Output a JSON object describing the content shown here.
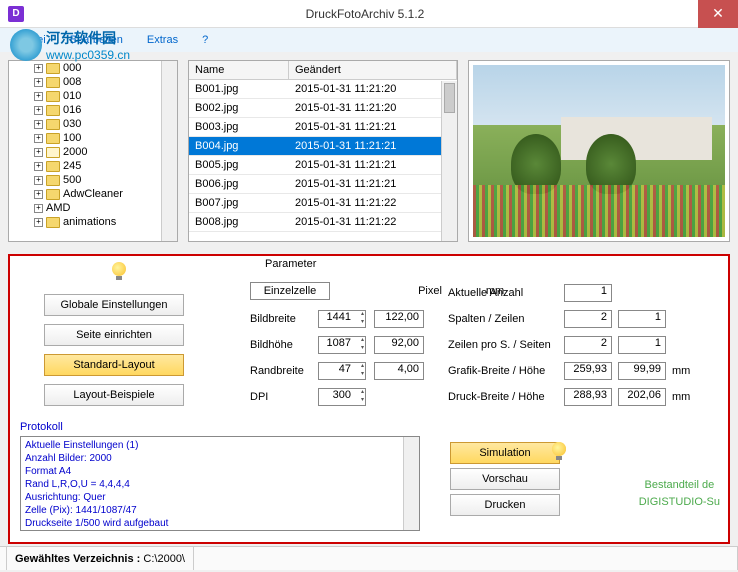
{
  "titlebar": {
    "title": "DruckFotoArchiv  5.1.2",
    "icon_letter": "D"
  },
  "watermark": {
    "title": "河东软件园",
    "url": "www.pc0359.cn"
  },
  "menu": {
    "datei": "Datei",
    "bearbeiten": "Bearbeiten",
    "extras": "Extras",
    "help": "?"
  },
  "tree": {
    "items": [
      {
        "label": "000",
        "icon": "folder"
      },
      {
        "label": "008",
        "icon": "folder"
      },
      {
        "label": "010",
        "icon": "folder"
      },
      {
        "label": "016",
        "icon": "folder"
      },
      {
        "label": "030",
        "icon": "folder"
      },
      {
        "label": "100",
        "icon": "folder"
      },
      {
        "label": "2000",
        "icon": "folder-open"
      },
      {
        "label": "245",
        "icon": "folder"
      },
      {
        "label": "500",
        "icon": "folder"
      },
      {
        "label": "AdwCleaner",
        "icon": "folder"
      },
      {
        "label": "AMD",
        "icon": "none"
      },
      {
        "label": "animations",
        "icon": "folder"
      }
    ]
  },
  "table": {
    "headers": {
      "name": "Name",
      "date": "Geändert"
    },
    "rows": [
      {
        "name": "B001.jpg",
        "date": "2015-01-31 11:21:20"
      },
      {
        "name": "B002.jpg",
        "date": "2015-01-31 11:21:20"
      },
      {
        "name": "B003.jpg",
        "date": "2015-01-31 11:21:21"
      },
      {
        "name": "B004.jpg",
        "date": "2015-01-31 11:21:21",
        "selected": true
      },
      {
        "name": "B005.jpg",
        "date": "2015-01-31 11:21:21"
      },
      {
        "name": "B006.jpg",
        "date": "2015-01-31 11:21:21"
      },
      {
        "name": "B007.jpg",
        "date": "2015-01-31 11:21:22"
      },
      {
        "name": "B008.jpg",
        "date": "2015-01-31 11:21:22"
      }
    ]
  },
  "params": {
    "title": "Parameter",
    "header_pixel": "Pixel",
    "header_mm": "mm",
    "einzelzelle": "Einzelzelle",
    "labels": {
      "bildbreite": "Bildbreite",
      "bildhoehe": "Bildhöhe",
      "randbreite": "Randbreite",
      "dpi": "DPI"
    },
    "values": {
      "bildbreite_px": "1441",
      "bildbreite_mm": "122,00",
      "bildhoehe_px": "1087",
      "bildhoehe_mm": "92,00",
      "randbreite_px": "47",
      "randbreite_mm": "4,00",
      "dpi": "300"
    }
  },
  "right": {
    "labels": {
      "anzahl": "Aktuelle Anzahl",
      "spalten": "Spalten / Zeilen",
      "zeilen_s": "Zeilen pro S. / Seiten",
      "grafik": "Grafik-Breite / Höhe",
      "druck": "Druck-Breite / Höhe"
    },
    "values": {
      "anzahl": "1",
      "spalten": "2",
      "zeilen": "1",
      "zeilen_s": "2",
      "seiten": "1",
      "grafik_b": "259,93",
      "grafik_h": "99,99",
      "druck_b": "288,93",
      "druck_h": "202,06"
    },
    "unit": "mm"
  },
  "buttons": {
    "globale": "Globale Einstellungen",
    "seite": "Seite einrichten",
    "standard": "Standard-Layout",
    "layout": "Layout-Beispiele",
    "simulation": "Simulation",
    "vorschau": "Vorschau",
    "drucken": "Drucken"
  },
  "protokoll": {
    "title": "Protokoll",
    "lines": [
      "Aktuelle Einstellungen (1)",
      "Anzahl Bilder: 2000",
      "Format          A4",
      "Rand            L,R,O,U = 4,4,4,4",
      "Ausrichtung:   Quer",
      "Zelle (Pix):      1441/1087/47",
      "Druckseite 1/500 wird aufgebaut"
    ]
  },
  "brand": {
    "line1": "Bestandteil de",
    "line2": "DIGISTUDIO-Su"
  },
  "status": {
    "label": "Gewähltes Verzeichnis :",
    "value": "C:\\2000\\"
  }
}
